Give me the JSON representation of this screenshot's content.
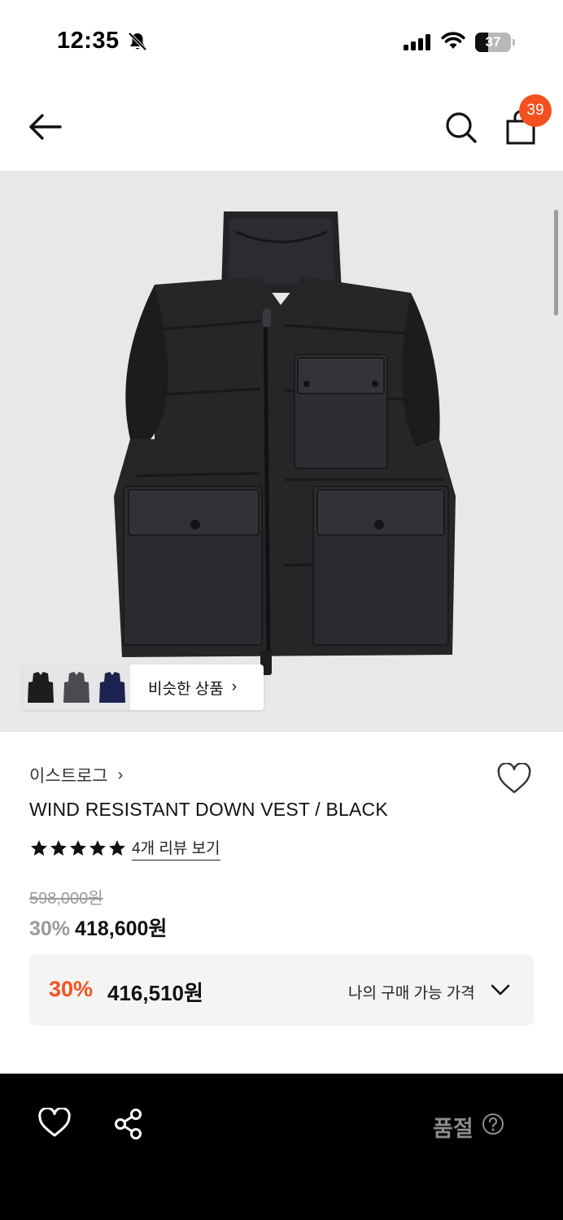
{
  "status_bar": {
    "time": "12:35",
    "battery_level": "37",
    "battery_fraction": 0.37
  },
  "nav": {
    "cart_count": "39",
    "accent_color": "#f4511e",
    "icons": [
      "back-arrow-icon",
      "search-icon",
      "shopping-bag-icon"
    ]
  },
  "product_image": {
    "similar_button_label": "비슷한 상품",
    "similar_arrow": "›",
    "thumbnails": [
      "black-vest-thumbnail",
      "charcoal-vest-thumbnail",
      "navy-vest-thumbnail"
    ]
  },
  "product": {
    "brand": "이스트로그",
    "brand_chevron": "›",
    "title": "WIND RESISTANT DOWN VEST / BLACK",
    "rating_stars": 5,
    "review_link": "4개 리뷰 보기",
    "original_price": "598,000원",
    "discount_rate": "30%",
    "sale_price": "418,600원"
  },
  "my_price": {
    "discount_rate": "30%",
    "price": "416,510원",
    "label": "나의 구매 가능 가격"
  },
  "bottom_bar": {
    "status_label": "품절",
    "icons": [
      "heart-icon",
      "share-icon",
      "help-icon"
    ]
  }
}
